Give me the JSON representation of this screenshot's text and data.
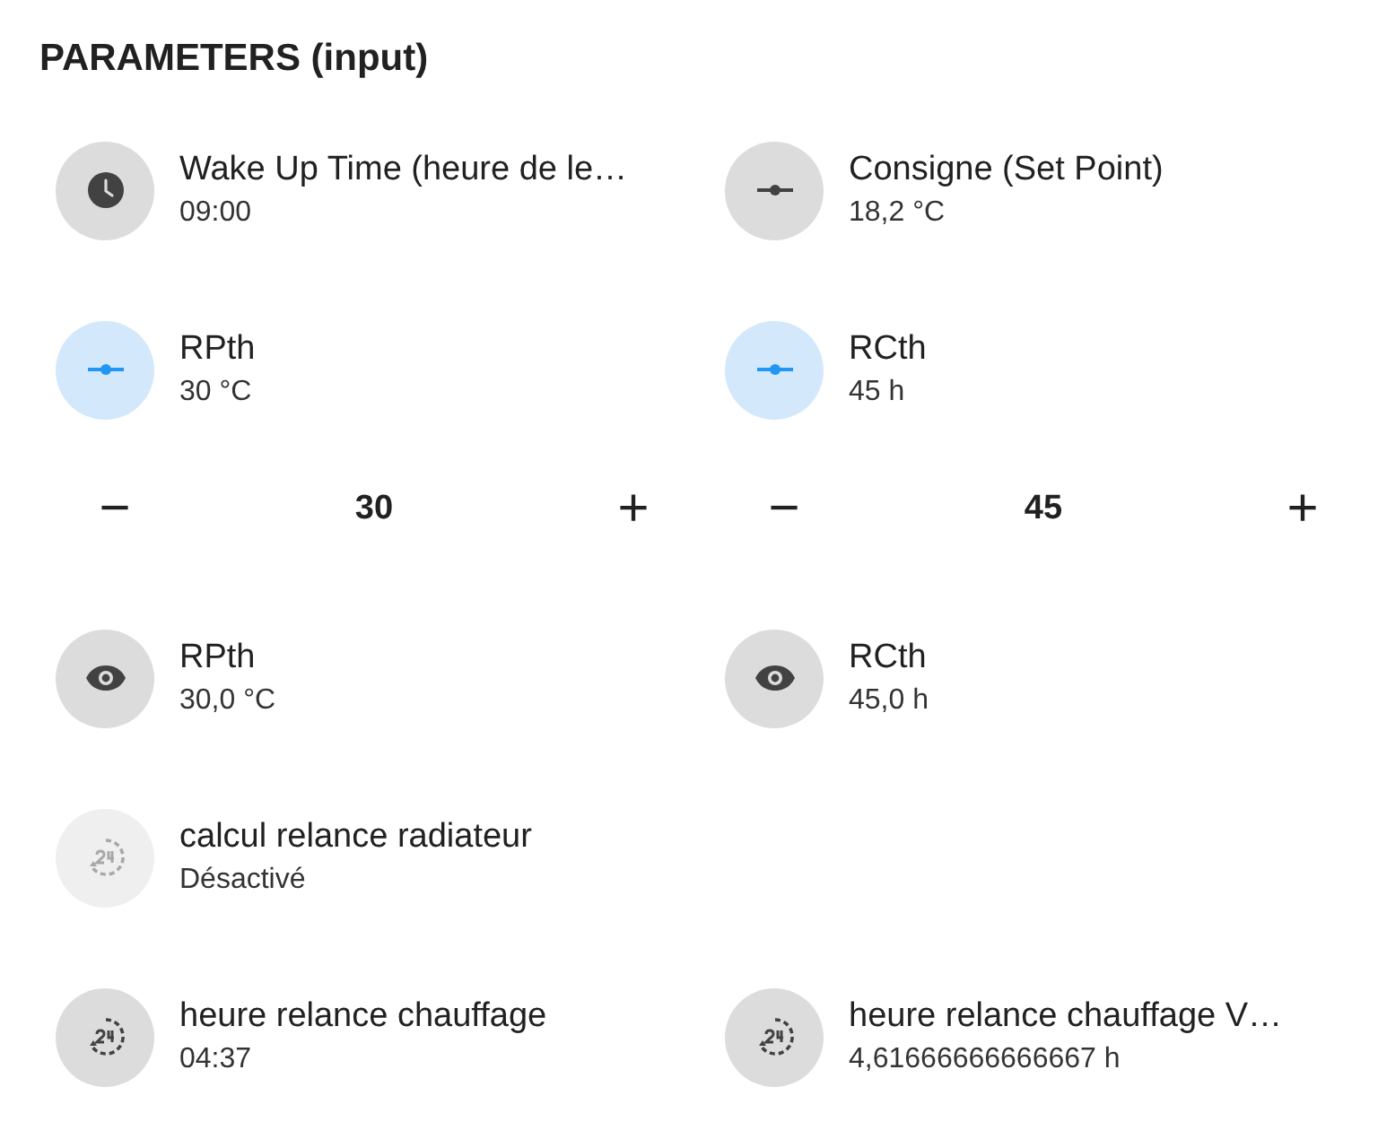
{
  "title": "PARAMETERS (input)",
  "rows": [
    {
      "cells": [
        {
          "kind": "tile",
          "active": false,
          "disabled": false,
          "name": "Wake Up Time (heure de le…",
          "state": "09:00"
        },
        {
          "kind": "tile",
          "active": false,
          "disabled": false,
          "name": "Consigne (Set Point)",
          "state": "18,2 °C"
        }
      ]
    },
    {
      "cells": [
        {
          "kind": "tile",
          "active": true,
          "disabled": false,
          "name": "RPth",
          "state": "30 °C"
        },
        {
          "kind": "tile",
          "active": true,
          "disabled": false,
          "name": "RCth",
          "state": "45 h"
        }
      ]
    },
    {
      "cells": [
        {
          "kind": "stepper",
          "minus": "−",
          "value": "30",
          "plus": "+"
        },
        {
          "kind": "stepper",
          "minus": "−",
          "value": "45",
          "plus": "+"
        }
      ]
    },
    {
      "cells": [
        {
          "kind": "tile",
          "active": false,
          "disabled": false,
          "name": "RPth",
          "state": "30,0 °C"
        },
        {
          "kind": "tile",
          "active": false,
          "disabled": false,
          "name": "RCth",
          "state": "45,0 h"
        }
      ]
    },
    {
      "cells": [
        {
          "kind": "tile",
          "active": false,
          "disabled": true,
          "name": "calcul relance radiateur",
          "state": "Désactivé"
        }
      ]
    },
    {
      "cells": [
        {
          "kind": "tile",
          "active": false,
          "disabled": false,
          "name": "heure relance chauffage",
          "state": "04:37"
        },
        {
          "kind": "tile",
          "active": false,
          "disabled": false,
          "name": "heure relance chauffage V…",
          "state": "4,61666666666667 h"
        }
      ]
    }
  ]
}
